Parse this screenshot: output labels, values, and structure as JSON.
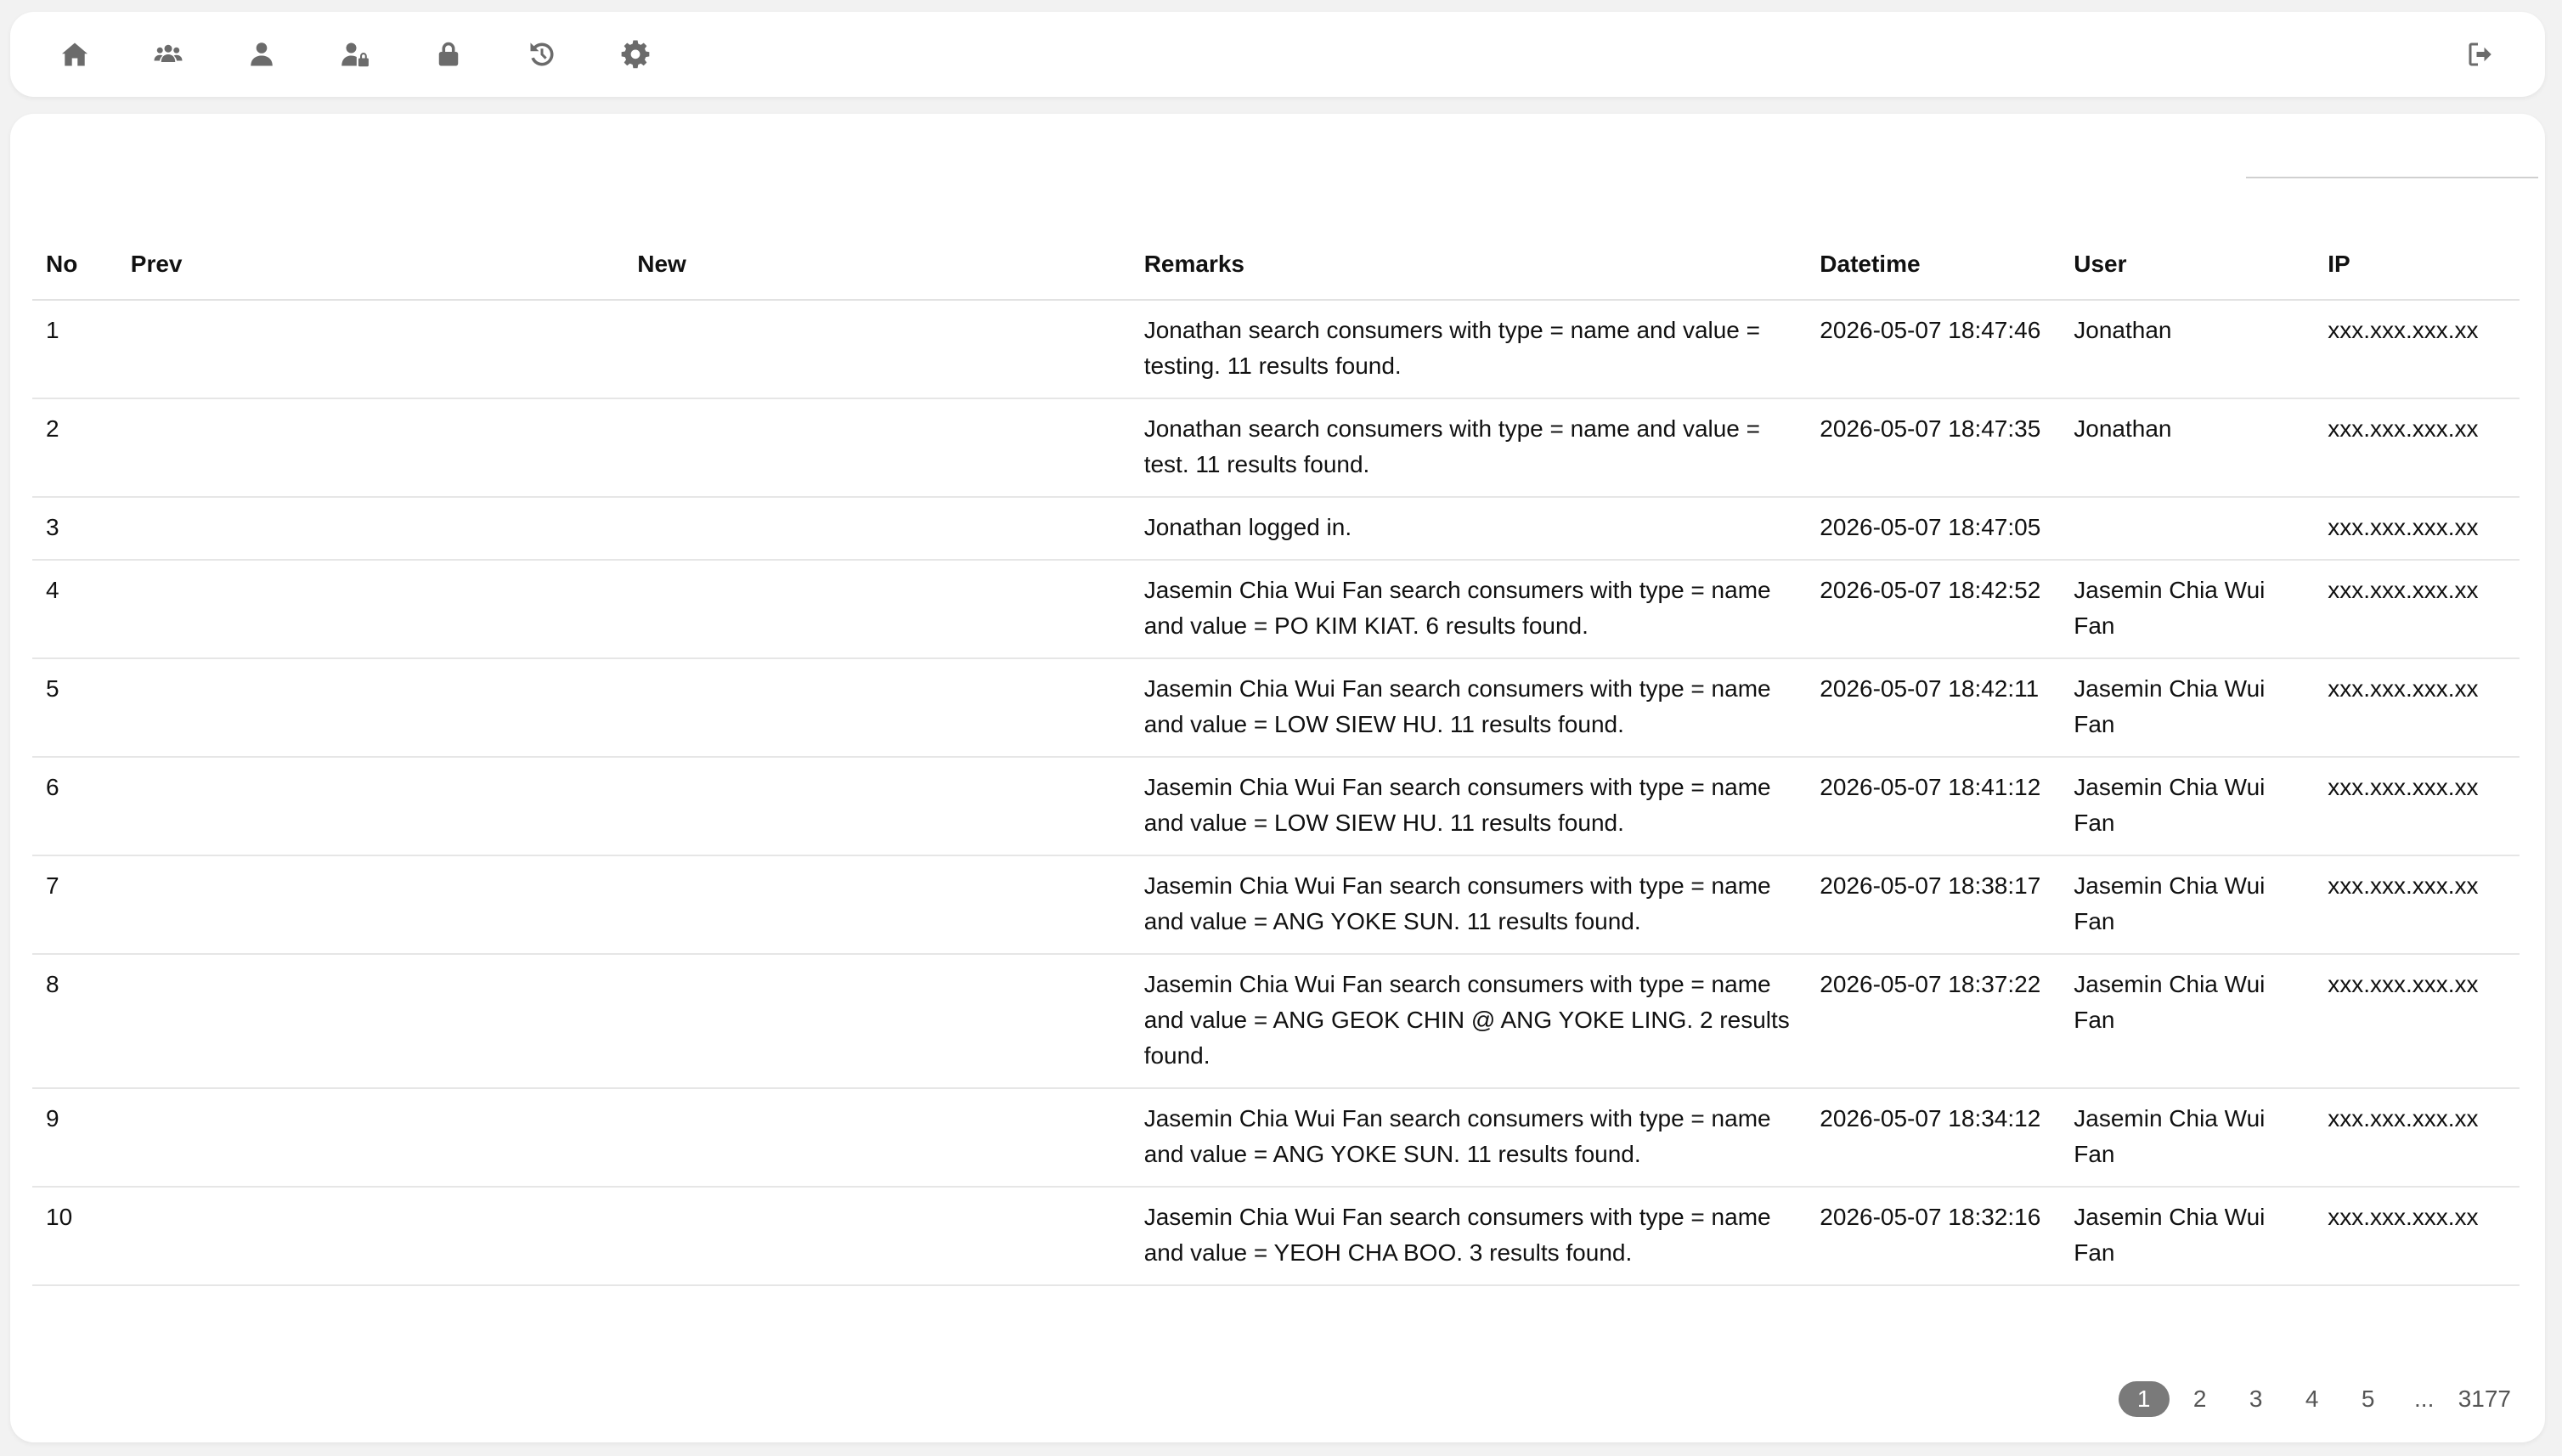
{
  "nav": {
    "icons": [
      "home-icon",
      "users-group-icon",
      "user-icon",
      "user-lock-icon",
      "lock-icon",
      "history-icon",
      "gear-icon",
      "logout-icon"
    ]
  },
  "search": {
    "placeholder": ""
  },
  "table": {
    "headers": {
      "no": "No",
      "prev": "Prev",
      "new": "New",
      "remarks": "Remarks",
      "datetime": "Datetime",
      "user": "User",
      "ip": "IP"
    },
    "rows": [
      {
        "no": "1",
        "prev": "",
        "new": "",
        "remarks": "Jonathan search consumers with type = name and value = testing. 11 results found.",
        "datetime": "2026-05-07 18:47:46",
        "user": "Jonathan",
        "ip": "xxx.xxx.xxx.xx"
      },
      {
        "no": "2",
        "prev": "",
        "new": "",
        "remarks": "Jonathan search consumers with type = name and value = test. 11 results found.",
        "datetime": "2026-05-07 18:47:35",
        "user": "Jonathan",
        "ip": "xxx.xxx.xxx.xx"
      },
      {
        "no": "3",
        "prev": "",
        "new": "",
        "remarks": "Jonathan logged in.",
        "datetime": "2026-05-07 18:47:05",
        "user": "",
        "ip": "xxx.xxx.xxx.xx"
      },
      {
        "no": "4",
        "prev": "",
        "new": "",
        "remarks": "Jasemin Chia Wui Fan search consumers with type = name and value = PO KIM KIAT. 6 results found.",
        "datetime": "2026-05-07 18:42:52",
        "user": "Jasemin Chia Wui Fan",
        "ip": "xxx.xxx.xxx.xx"
      },
      {
        "no": "5",
        "prev": "",
        "new": "",
        "remarks": "Jasemin Chia Wui Fan search consumers with type = name and value = LOW SIEW HU. 11 results found.",
        "datetime": "2026-05-07 18:42:11",
        "user": "Jasemin Chia Wui Fan",
        "ip": "xxx.xxx.xxx.xx"
      },
      {
        "no": "6",
        "prev": "",
        "new": "",
        "remarks": "Jasemin Chia Wui Fan search consumers with type = name and value = LOW SIEW HU. 11 results found.",
        "datetime": "2026-05-07 18:41:12",
        "user": "Jasemin Chia Wui Fan",
        "ip": "xxx.xxx.xxx.xx"
      },
      {
        "no": "7",
        "prev": "",
        "new": "",
        "remarks": "Jasemin Chia Wui Fan search consumers with type = name and value = ANG YOKE SUN. 11 results found.",
        "datetime": "2026-05-07 18:38:17",
        "user": "Jasemin Chia Wui Fan",
        "ip": "xxx.xxx.xxx.xx"
      },
      {
        "no": "8",
        "prev": "",
        "new": "",
        "remarks": "Jasemin Chia Wui Fan search consumers with type = name and value = ANG GEOK CHIN @ ANG YOKE LING. 2 results found.",
        "datetime": "2026-05-07 18:37:22",
        "user": "Jasemin Chia Wui Fan",
        "ip": "xxx.xxx.xxx.xx"
      },
      {
        "no": "9",
        "prev": "",
        "new": "",
        "remarks": "Jasemin Chia Wui Fan search consumers with type = name and value = ANG YOKE SUN. 11 results found.",
        "datetime": "2026-05-07 18:34:12",
        "user": "Jasemin Chia Wui Fan",
        "ip": "xxx.xxx.xxx.xx"
      },
      {
        "no": "10",
        "prev": "",
        "new": "",
        "remarks": "Jasemin Chia Wui Fan search consumers with type = name and value = YEOH CHA BOO. 3 results found.",
        "datetime": "2026-05-07 18:32:16",
        "user": "Jasemin Chia Wui Fan",
        "ip": "xxx.xxx.xxx.xx"
      }
    ]
  },
  "pagination": {
    "pages": [
      "1",
      "2",
      "3",
      "4",
      "5",
      "...",
      "3177"
    ],
    "current": "1"
  },
  "colors": {
    "page_bg": "#f2f2f2",
    "card_bg": "#ffffff",
    "icon_gray": "#6b6b6b",
    "active_page_bg": "#7a7a7a"
  }
}
